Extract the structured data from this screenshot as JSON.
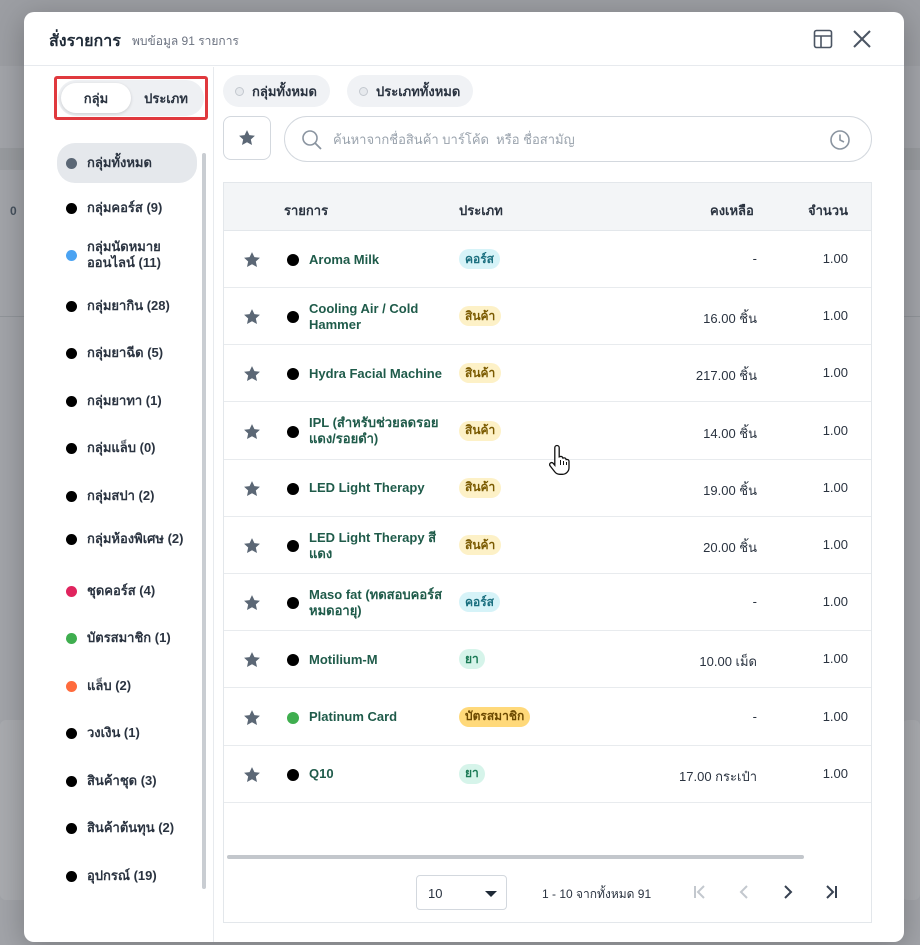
{
  "background": {
    "visible_value": "0"
  },
  "modal": {
    "title": "สั่งรายการ",
    "subtitle": "พบข้อมูล 91 รายการ",
    "layout_icon": "layout-icon",
    "close_icon": "close-icon"
  },
  "toggle": {
    "options": [
      "กลุ่ม",
      "ประเภท"
    ],
    "active": "กลุ่ม"
  },
  "groups": [
    {
      "label": "กลุ่มทั้งหมด",
      "color": "#5b6775",
      "active": true
    },
    {
      "label": "กลุ่มคอร์ส (9)",
      "color": "#000000"
    },
    {
      "label": "กลุ่มนัดหมายออนไลน์ (11)",
      "color": "#4ba3f2"
    },
    {
      "label": "กลุ่มยากิน (28)",
      "color": "#000000"
    },
    {
      "label": "กลุ่มยาฉีด (5)",
      "color": "#000000"
    },
    {
      "label": "กลุ่มยาทา (1)",
      "color": "#000000"
    },
    {
      "label": "กลุ่มแล็บ (0)",
      "color": "#000000"
    },
    {
      "label": "กลุ่มสปา (2)",
      "color": "#000000"
    },
    {
      "label": "กลุ่มห้องพิเศษ (2)",
      "color": "#000000"
    },
    {
      "label": "ชุดคอร์ส (4)",
      "color": "#e0245e"
    },
    {
      "label": "บัตรสมาชิก (1)",
      "color": "#3fae4f"
    },
    {
      "label": "แล็บ (2)",
      "color": "#ff6b3d"
    },
    {
      "label": "วงเงิน (1)",
      "color": "#000000"
    },
    {
      "label": "สินค้าชุด (3)",
      "color": "#000000"
    },
    {
      "label": "สินค้าต้นทุน (2)",
      "color": "#000000"
    },
    {
      "label": "อุปกรณ์ (19)",
      "color": "#000000"
    }
  ],
  "chips": {
    "all_groups": "กลุ่มทั้งหมด",
    "all_types": "ประเภททั้งหมด"
  },
  "search": {
    "placeholder": "ค้นหาจากชื่อสินค้า บาร์โค้ด  หรือ ชื่อสามัญ",
    "value": "",
    "icon": "search-icon",
    "history_icon": "clock-icon"
  },
  "table": {
    "headers": {
      "item": "รายการ",
      "type": "ประเภท",
      "remaining": "คงเหลือ",
      "qty": "จำนวน"
    },
    "rows": [
      {
        "name": "Aroma Milk",
        "dot": "#000000",
        "type": "คอร์ส",
        "type_kind": "course",
        "remaining": "-",
        "qty": "1.00"
      },
      {
        "name": "Cooling Air / Cold Hammer",
        "dot": "#000000",
        "type": "สินค้า",
        "type_kind": "product",
        "remaining": "16.00 ชิ้น",
        "qty": "1.00"
      },
      {
        "name": "Hydra Facial Machine",
        "dot": "#000000",
        "type": "สินค้า",
        "type_kind": "product",
        "remaining": "217.00 ชิ้น",
        "qty": "1.00"
      },
      {
        "name": "IPL (สำหรับช่วยลดรอยแดง/รอยดำ)",
        "dot": "#000000",
        "type": "สินค้า",
        "type_kind": "product",
        "remaining": "14.00 ชิ้น",
        "qty": "1.00"
      },
      {
        "name": "LED Light Therapy",
        "dot": "#000000",
        "type": "สินค้า",
        "type_kind": "product",
        "remaining": "19.00 ชิ้น",
        "qty": "1.00"
      },
      {
        "name": "LED Light Therapy สีแดง",
        "dot": "#000000",
        "type": "สินค้า",
        "type_kind": "product",
        "remaining": "20.00 ชิ้น",
        "qty": "1.00"
      },
      {
        "name": "Maso fat (ทดสอบคอร์สหมดอายุ)",
        "dot": "#000000",
        "type": "คอร์ส",
        "type_kind": "course",
        "remaining": "-",
        "qty": "1.00"
      },
      {
        "name": "Motilium-M",
        "dot": "#000000",
        "type": "ยา",
        "type_kind": "drug",
        "remaining": "10.00 เม็ด",
        "qty": "1.00"
      },
      {
        "name": "Platinum Card",
        "dot": "#3fae4f",
        "type": "บัตรสมาชิก",
        "type_kind": "member",
        "remaining": "-",
        "qty": "1.00"
      },
      {
        "name": "Q10",
        "dot": "#000000",
        "type": "ยา",
        "type_kind": "drug",
        "remaining": "17.00 กระเป๋า",
        "qty": "1.00"
      }
    ]
  },
  "pagination": {
    "page_size": "10",
    "info": "1 - 10 จากทั้งหมด 91",
    "first_icon": "first-page-icon",
    "prev_icon": "prev-page-icon",
    "next_icon": "next-page-icon",
    "last_icon": "last-page-icon"
  }
}
